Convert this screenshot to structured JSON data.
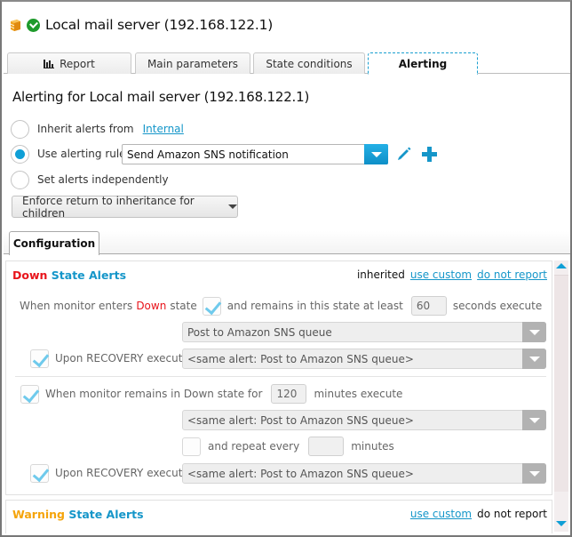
{
  "header": {
    "title": "Local mail server (192.168.122.1)",
    "status_color": "#1e9a2b",
    "icons": [
      "server-box-icon",
      "status-ok-icon"
    ]
  },
  "tabs": [
    {
      "label": "Report",
      "icon": "bar-chart-icon",
      "active": false
    },
    {
      "label": "Main parameters",
      "active": false
    },
    {
      "label": "State conditions",
      "active": false
    },
    {
      "label": "Alerting",
      "active": true
    }
  ],
  "alerting": {
    "title": "Alerting for Local mail server (192.168.122.1)",
    "options": {
      "inherit": {
        "label": "Inherit alerts from",
        "link": "Internal",
        "selected": false
      },
      "use_rule": {
        "label": "Use alerting rule",
        "selected": true
      },
      "independent": {
        "label": "Set alerts independently",
        "selected": false
      }
    },
    "rule_select": {
      "value": "Send Amazon SNS notification"
    },
    "enforce_button": "Enforce return to inheritance for children"
  },
  "config_tab": {
    "label": "Configuration"
  },
  "down_alerts": {
    "title_state": "Down",
    "title_rest": "State Alerts",
    "status": "inherited",
    "use_custom": "use custom",
    "do_not_report": "do not report",
    "enters_prefix": "When monitor enters",
    "enters_state": "Down",
    "enters_suffix": "state",
    "enters_checked": true,
    "remains_label": "and remains in this state at least",
    "remains_value": "60",
    "remains_unit": "seconds execute",
    "action_1": "Post to Amazon SNS queue",
    "recovery_1": {
      "label": "Upon RECOVERY execute",
      "checked": true,
      "value": "<same alert: Post to Amazon SNS queue>"
    },
    "long_down": {
      "checked": true,
      "label": "When monitor remains in Down state for",
      "value": "120",
      "unit": "minutes execute"
    },
    "action_2": "<same alert: Post to Amazon SNS queue>",
    "repeat": {
      "checked": false,
      "label": "and repeat every",
      "value": "",
      "unit": "minutes"
    },
    "recovery_2": {
      "label": "Upon RECOVERY execute",
      "checked": true,
      "value": "<same alert: Post to Amazon SNS queue>"
    }
  },
  "warning_alerts": {
    "title_state": "Warning",
    "title_rest": "State Alerts",
    "use_custom": "use custom",
    "do_not_report": "do not report"
  },
  "colors": {
    "accent": "#1596c9",
    "down": "#e8141b",
    "warning": "#f5a40a"
  }
}
